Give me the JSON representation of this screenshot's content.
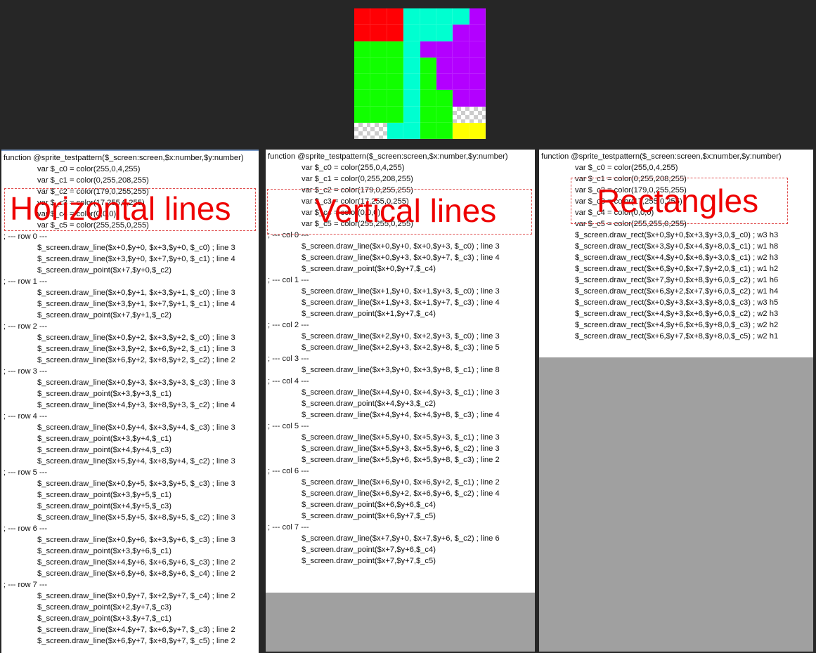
{
  "sprite": {
    "rows": [
      [
        "red",
        "red",
        "red",
        "cyan",
        "cyan",
        "cyan",
        "cyan",
        "purple"
      ],
      [
        "red",
        "red",
        "red",
        "cyan",
        "cyan",
        "cyan",
        "purple",
        "purple"
      ],
      [
        "green",
        "green",
        "green",
        "cyan",
        "purple",
        "purple",
        "purple",
        "purple"
      ],
      [
        "green",
        "green",
        "green",
        "cyan",
        "green",
        "purple",
        "purple",
        "purple"
      ],
      [
        "green",
        "green",
        "green",
        "cyan",
        "green",
        "purple",
        "purple",
        "purple"
      ],
      [
        "green",
        "green",
        "green",
        "cyan",
        "green",
        "green",
        "purple",
        "purple"
      ],
      [
        "green",
        "green",
        "green",
        "cyan",
        "green",
        "green",
        "transparent",
        "transparent"
      ],
      [
        "transparent",
        "transparent",
        "cyan",
        "cyan",
        "green",
        "green",
        "yellow",
        "yellow"
      ]
    ],
    "colors": {
      "red": "#ff0004",
      "cyan": "#00ffd0",
      "purple": "#b300ff",
      "green": "#11ff00",
      "yellow": "#ffff00"
    }
  },
  "panels": [
    {
      "overlay": "Horizontal lines",
      "lines": [
        "function @sprite_testpattern($_screen:screen,$x:number,$y:number)",
        "\tvar $_c0 = color(255,0,4,255)",
        "\tvar $_c1 = color(0,255,208,255)",
        "\tvar $_c2 = color(179,0,255,255)",
        "\tvar $_c3 = color(17,255,0,255)",
        "\tvar $_c4 = color(0,0,0)",
        "\tvar $_c5 = color(255,255,0,255)",
        "; --- row 0 ---",
        "\t$_screen.draw_line($x+0,$y+0, $x+3,$y+0, $_c0) ; line 3",
        "\t$_screen.draw_line($x+3,$y+0, $x+7,$y+0, $_c1) ; line 4",
        "\t$_screen.draw_point($x+7,$y+0,$_c2)",
        "; --- row 1 ---",
        "\t$_screen.draw_line($x+0,$y+1, $x+3,$y+1, $_c0) ; line 3",
        "\t$_screen.draw_line($x+3,$y+1, $x+7,$y+1, $_c1) ; line 4",
        "\t$_screen.draw_point($x+7,$y+1,$_c2)",
        "; --- row 2 ---",
        "\t$_screen.draw_line($x+0,$y+2, $x+3,$y+2, $_c0) ; line 3",
        "\t$_screen.draw_line($x+3,$y+2, $x+6,$y+2, $_c1) ; line 3",
        "\t$_screen.draw_line($x+6,$y+2, $x+8,$y+2, $_c2) ; line 2",
        "; --- row 3 ---",
        "\t$_screen.draw_line($x+0,$y+3, $x+3,$y+3, $_c3) ; line 3",
        "\t$_screen.draw_point($x+3,$y+3,$_c1)",
        "\t$_screen.draw_line($x+4,$y+3, $x+8,$y+3, $_c2) ; line 4",
        "; --- row 4 ---",
        "\t$_screen.draw_line($x+0,$y+4, $x+3,$y+4, $_c3) ; line 3",
        "\t$_screen.draw_point($x+3,$y+4,$_c1)",
        "\t$_screen.draw_point($x+4,$y+4,$_c3)",
        "\t$_screen.draw_line($x+5,$y+4, $x+8,$y+4, $_c2) ; line 3",
        "; --- row 5 ---",
        "\t$_screen.draw_line($x+0,$y+5, $x+3,$y+5, $_c3) ; line 3",
        "\t$_screen.draw_point($x+3,$y+5,$_c1)",
        "\t$_screen.draw_point($x+4,$y+5,$_c3)",
        "\t$_screen.draw_line($x+5,$y+5, $x+8,$y+5, $_c2) ; line 3",
        "; --- row 6 ---",
        "\t$_screen.draw_line($x+0,$y+6, $x+3,$y+6, $_c3) ; line 3",
        "\t$_screen.draw_point($x+3,$y+6,$_c1)",
        "\t$_screen.draw_line($x+4,$y+6, $x+6,$y+6, $_c3) ; line 2",
        "\t$_screen.draw_line($x+6,$y+6, $x+8,$y+6, $_c4) ; line 2",
        "; --- row 7 ---",
        "\t$_screen.draw_line($x+0,$y+7, $x+2,$y+7, $_c4) ; line 2",
        "\t$_screen.draw_point($x+2,$y+7,$_c3)",
        "\t$_screen.draw_point($x+3,$y+7,$_c1)",
        "\t$_screen.draw_line($x+4,$y+7, $x+6,$y+7, $_c3) ; line 2",
        "\t$_screen.draw_line($x+6,$y+7, $x+8,$y+7, $_c5) ; line 2"
      ]
    },
    {
      "overlay": "Vertical lines",
      "lines": [
        "function @sprite_testpattern($_screen:screen,$x:number,$y:number)",
        "\tvar $_c0 = color(255,0,4,255)",
        "\tvar $_c1 = color(0,255,208,255)",
        "\tvar $_c2 = color(179,0,255,255)",
        "\tvar $_c3 = color(17,255,0,255)",
        "\tvar $_c4 = color(0,0,0)",
        "\tvar $_c5 = color(255,255,0,255)",
        "; --- col 0 ---",
        "\t$_screen.draw_line($x+0,$y+0, $x+0,$y+3, $_c0) ; line 3",
        "\t$_screen.draw_line($x+0,$y+3, $x+0,$y+7, $_c3) ; line 4",
        "\t$_screen.draw_point($x+0,$y+7,$_c4)",
        "; --- col 1 ---",
        "\t$_screen.draw_line($x+1,$y+0, $x+1,$y+3, $_c0) ; line 3",
        "\t$_screen.draw_line($x+1,$y+3, $x+1,$y+7, $_c3) ; line 4",
        "\t$_screen.draw_point($x+1,$y+7,$_c4)",
        "; --- col 2 ---",
        "\t$_screen.draw_line($x+2,$y+0, $x+2,$y+3, $_c0) ; line 3",
        "\t$_screen.draw_line($x+2,$y+3, $x+2,$y+8, $_c3) ; line 5",
        "; --- col 3 ---",
        "\t$_screen.draw_line($x+3,$y+0, $x+3,$y+8, $_c1) ; line 8",
        "; --- col 4 ---",
        "\t$_screen.draw_line($x+4,$y+0, $x+4,$y+3, $_c1) ; line 3",
        "\t$_screen.draw_point($x+4,$y+3,$_c2)",
        "\t$_screen.draw_line($x+4,$y+4, $x+4,$y+8, $_c3) ; line 4",
        "; --- col 5 ---",
        "\t$_screen.draw_line($x+5,$y+0, $x+5,$y+3, $_c1) ; line 3",
        "\t$_screen.draw_line($x+5,$y+3, $x+5,$y+6, $_c2) ; line 3",
        "\t$_screen.draw_line($x+5,$y+6, $x+5,$y+8, $_c3) ; line 2",
        "; --- col 6 ---",
        "\t$_screen.draw_line($x+6,$y+0, $x+6,$y+2, $_c1) ; line 2",
        "\t$_screen.draw_line($x+6,$y+2, $x+6,$y+6, $_c2) ; line 4",
        "\t$_screen.draw_point($x+6,$y+6,$_c4)",
        "\t$_screen.draw_point($x+6,$y+7,$_c5)",
        "; --- col 7 ---",
        "\t$_screen.draw_line($x+7,$y+0, $x+7,$y+6, $_c2) ; line 6",
        "\t$_screen.draw_point($x+7,$y+6,$_c4)",
        "\t$_screen.draw_point($x+7,$y+7,$_c5)"
      ]
    },
    {
      "overlay": "Rectangles",
      "lines": [
        "function @sprite_testpattern($_screen:screen,$x:number,$y:number)",
        "\tvar $_c0 = color(255,0,4,255)",
        "\tvar $_c1 = color(0,255,208,255)",
        "\tvar $_c2 = color(179,0,255,255)",
        "\tvar $_c3 = color(17,255,0,255)",
        "\tvar $_c4 = color(0,0,0)",
        "\tvar $_c5 = color(255,255,0,255)",
        "\t$_screen.draw_rect($x+0,$y+0,$x+3,$y+3,0,$_c0) ; w3 h3",
        "\t$_screen.draw_rect($x+3,$y+0,$x+4,$y+8,0,$_c1) ; w1 h8",
        "\t$_screen.draw_rect($x+4,$y+0,$x+6,$y+3,0,$_c1) ; w2 h3",
        "\t$_screen.draw_rect($x+6,$y+0,$x+7,$y+2,0,$_c1) ; w1 h2",
        "\t$_screen.draw_rect($x+7,$y+0,$x+8,$y+6,0,$_c2) ; w1 h6",
        "\t$_screen.draw_rect($x+6,$y+2,$x+7,$y+6,0,$_c2) ; w1 h4",
        "\t$_screen.draw_rect($x+0,$y+3,$x+3,$y+8,0,$_c3) ; w3 h5",
        "\t$_screen.draw_rect($x+4,$y+3,$x+6,$y+6,0,$_c2) ; w2 h3",
        "\t$_screen.draw_rect($x+4,$y+6,$x+6,$y+8,0,$_c3) ; w2 h2",
        "\t$_screen.draw_rect($x+6,$y+7,$x+8,$y+8,0,$_c5) ; w2 h1"
      ]
    }
  ]
}
